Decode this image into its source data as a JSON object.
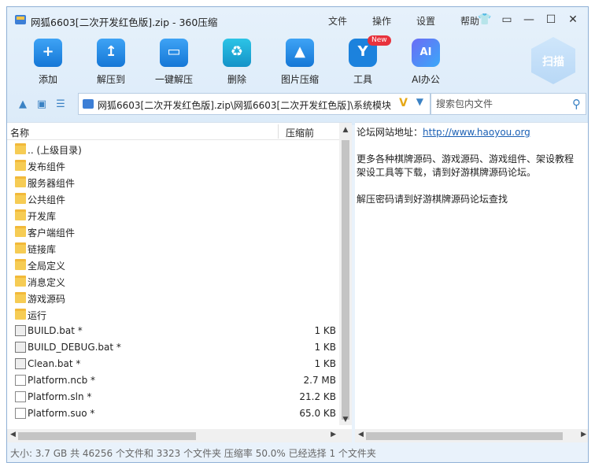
{
  "window": {
    "title": "网狐6603[二次开发红色版].zip - 360压缩"
  },
  "menu": [
    "文件",
    "操作",
    "设置",
    "帮助"
  ],
  "window_controls": {
    "skin": "👕",
    "message": "▭",
    "minimize": "—",
    "maximize": "☐",
    "close": "✕"
  },
  "toolbar": [
    {
      "label": "添加",
      "icon": "add-icon",
      "glyph": "+",
      "style": "blue"
    },
    {
      "label": "解压到",
      "icon": "extract-to-icon",
      "glyph": "↥",
      "style": "blue"
    },
    {
      "label": "一键解压",
      "icon": "one-click-extract-icon",
      "glyph": "▭",
      "style": "blue"
    },
    {
      "label": "删除",
      "icon": "delete-icon",
      "glyph": "♻",
      "style": "teal"
    },
    {
      "label": "图片压缩",
      "icon": "image-compress-icon",
      "glyph": "▲",
      "style": "blue"
    },
    {
      "label": "工具",
      "icon": "tools-icon",
      "glyph": "Y",
      "style": "hex",
      "badge": "New"
    },
    {
      "label": "AI办公",
      "icon": "ai-office-icon",
      "glyph": "AI",
      "style": "ai"
    }
  ],
  "scan_label": "扫描",
  "nav": {
    "up": "▲",
    "view": "▣",
    "list": "☰"
  },
  "address": {
    "path": "网狐6603[二次开发红色版].zip\\网狐6603[二次开发红色版]\\系统模块",
    "mark": "V",
    "dropdown": "▼"
  },
  "search": {
    "placeholder": "搜索包内文件",
    "icon": "⚲"
  },
  "columns": {
    "name": "名称",
    "compressed": "压缩前"
  },
  "files": [
    {
      "name": ".. (上级目录)",
      "size": "",
      "type": "folder"
    },
    {
      "name": "发布组件",
      "size": "",
      "type": "folder"
    },
    {
      "name": "服务器组件",
      "size": "",
      "type": "folder"
    },
    {
      "name": "公共组件",
      "size": "",
      "type": "folder"
    },
    {
      "name": "开发库",
      "size": "",
      "type": "folder"
    },
    {
      "name": "客户端组件",
      "size": "",
      "type": "folder"
    },
    {
      "name": "链接库",
      "size": "",
      "type": "folder"
    },
    {
      "name": "全局定义",
      "size": "",
      "type": "folder"
    },
    {
      "name": "消息定义",
      "size": "",
      "type": "folder"
    },
    {
      "name": "游戏源码",
      "size": "",
      "type": "folder"
    },
    {
      "name": "运行",
      "size": "",
      "type": "folder"
    },
    {
      "name": "BUILD.bat *",
      "size": "1 KB",
      "type": "bat"
    },
    {
      "name": "BUILD_DEBUG.bat *",
      "size": "1 KB",
      "type": "bat"
    },
    {
      "name": "Clean.bat *",
      "size": "1 KB",
      "type": "bat"
    },
    {
      "name": "Platform.ncb *",
      "size": "2.7 MB",
      "type": "file"
    },
    {
      "name": "Platform.sln *",
      "size": "21.2 KB",
      "type": "file"
    },
    {
      "name": "Platform.suo *",
      "size": "65.0 KB",
      "type": "file"
    }
  ],
  "scroll": {
    "up": "▲",
    "down": "▼",
    "left": "◀",
    "right": "▶"
  },
  "readme": {
    "line1_prefix": "论坛网站地址：",
    "line1_link": "http://www.haoyou.org",
    "line2": "",
    "line3": "更多各种棋牌源码、游戏源码、游戏组件、架设教程",
    "line4": "架设工具等下载，请到好游棋牌源码论坛。",
    "line5": "",
    "line6": "解压密码请到好游棋牌源码论坛查找"
  },
  "status": "大小: 3.7 GB 共 46256 个文件和 3323 个文件夹 压缩率 50.0% 已经选择 1 个文件夹"
}
